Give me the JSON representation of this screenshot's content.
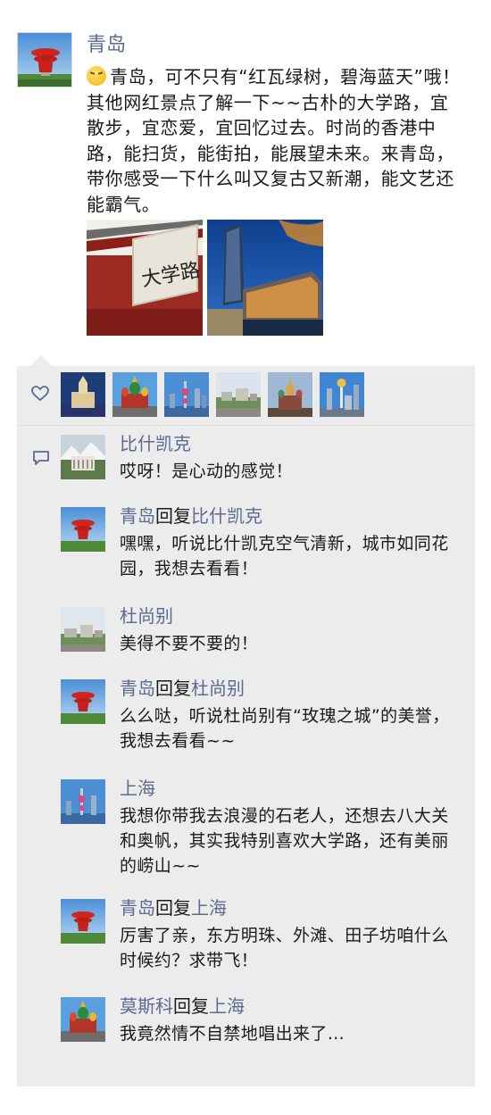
{
  "post": {
    "author": "青岛",
    "emoji": "smile-tongue-emoji",
    "text": "青岛，可不只有“红瓦绿树，碧海蓝天”哦！其他网红景点了解一下~~古朴的大学路，宜散步，宜恋爱，宜回忆过去。时尚的香港中路，能扫货，能街拍，能展望未来。来青岛，带你感受一下什么叫又复古又新潮，能文艺还能霸气。",
    "photos": [
      {
        "name": "daxue-road-sign-photo",
        "sign_text": "大学路"
      },
      {
        "name": "hongkong-middle-road-night-photo"
      }
    ]
  },
  "likes": {
    "icon": "heart-icon",
    "avatars": [
      "qingdao-avatar",
      "moscow-avatar",
      "shanghai-avatar",
      "dushanbe-avatar",
      "moscow-cathedral-avatar",
      "astana-avatar"
    ]
  },
  "comments": {
    "icon": "comment-icon",
    "reply_word": "回复",
    "items": [
      {
        "author": "比什凯克",
        "reply_to": "",
        "text": "哎呀！是心动的感觉！",
        "avatar": "bishkek-avatar"
      },
      {
        "author": "青岛",
        "reply_to": "比什凯克",
        "text": "嘿嘿，听说比什凯克空气清新，城市如同花园，我想去看看！",
        "avatar": "qingdao-avatar"
      },
      {
        "author": "杜尚别",
        "reply_to": "",
        "text": "美得不要不要的！",
        "avatar": "dushanbe-avatar"
      },
      {
        "author": "青岛",
        "reply_to": "杜尚别",
        "text": "么么哒，听说杜尚别有“玫瑰之城”的美誉，我想去看看~~",
        "avatar": "qingdao-avatar"
      },
      {
        "author": "上海",
        "reply_to": "",
        "text": "我想你带我去浪漫的石老人，还想去八大关和奥帆，其实我特别喜欢大学路，还有美丽的崂山~~",
        "avatar": "shanghai-avatar"
      },
      {
        "author": "青岛",
        "reply_to": "上海",
        "text": "厉害了亲，东方明珠、外滩、田子坊咱什么时候约？求带飞！",
        "avatar": "qingdao-avatar"
      },
      {
        "author": "莫斯科",
        "reply_to": "上海",
        "text": "我竟然情不自禁地唱出来了…",
        "avatar": "moscow-avatar"
      }
    ]
  },
  "colors": {
    "name_link": "#5b6a91",
    "panel_bg": "#ececec",
    "text": "#1a1a1a"
  }
}
